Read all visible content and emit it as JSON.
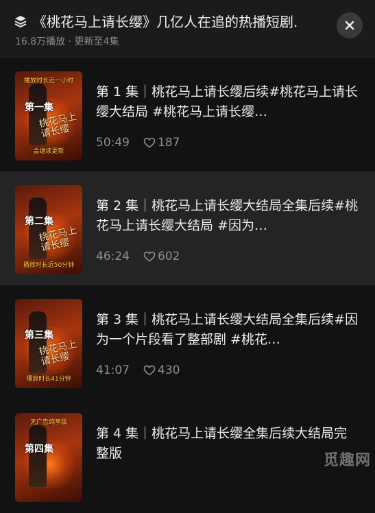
{
  "header": {
    "title": "《桃花马上请长缨》几亿人在追的热播短剧.",
    "subtitle": "16.8万播放 · 更新至4集"
  },
  "episodes": [
    {
      "title": "第 1 集｜桃花马上请长缨后续#桃花马上请长缨大结局 #桃花马上请长缨…",
      "duration": "50:49",
      "likes": "187",
      "thumb": {
        "mark": "第一集",
        "title": "桃花马上请长缨",
        "caption_top": "播放时长近一小时",
        "caption_bottom": "会继续更新"
      }
    },
    {
      "title": "第 2 集｜桃花马上请长缨大结局全集后续#桃花马上请长缨大结局 #因为…",
      "duration": "46:24",
      "likes": "602",
      "thumb": {
        "mark": "第二集",
        "title": "桃花马上请长缨",
        "caption_top": "",
        "caption_bottom": "播放时长近50分钟"
      }
    },
    {
      "title": "第 3 集｜桃花马上请长缨大结局全集后续#因为一个片段看了整部剧 #桃花…",
      "duration": "41:07",
      "likes": "430",
      "thumb": {
        "mark": "第三集",
        "title": "桃花马上请长缨",
        "caption_top": "",
        "caption_bottom": "播放时长41分钟"
      }
    },
    {
      "title": "第 4 集｜桃花马上请长缨全集后续大结局完整版",
      "duration": "",
      "likes": "",
      "thumb": {
        "mark": "第四集",
        "title": "",
        "caption_top": "无广告纯享版",
        "caption_bottom": ""
      }
    }
  ],
  "watermark": "觅趣网",
  "colors": {
    "background": "#121212",
    "header": "#1b1b1b",
    "active_row": "#242424",
    "muted": "#8e8e8e"
  },
  "icons": {
    "title": "collection-stack-icon",
    "close": "close-icon",
    "likes": "heart-outline-icon"
  }
}
